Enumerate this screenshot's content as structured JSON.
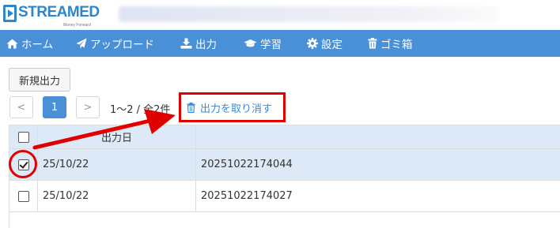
{
  "brand": {
    "logo_text": "STREAMED",
    "logo_subtext": "Money Forward"
  },
  "nav": {
    "items": [
      {
        "label": "ホーム",
        "icon": "home-icon"
      },
      {
        "label": "アップロード",
        "icon": "paper-plane-icon"
      },
      {
        "label": "出力",
        "icon": "download-icon"
      },
      {
        "label": "学習",
        "icon": "graduation-cap-icon"
      },
      {
        "label": "設定",
        "icon": "gear-icon"
      },
      {
        "label": "ゴミ箱",
        "icon": "trash-icon"
      }
    ]
  },
  "toolbar": {
    "new_output_label": "新規出力"
  },
  "pagination": {
    "prev": "<",
    "current_page": "1",
    "next": ">",
    "range_info": "1〜2 / 全2件"
  },
  "actions": {
    "cancel_output_label": "出力を取り消す"
  },
  "table": {
    "headers": {
      "date": "出力日",
      "name": ""
    },
    "rows": [
      {
        "checked": true,
        "date": "25/10/22",
        "name": "20251022174044"
      },
      {
        "checked": false,
        "date": "25/10/22",
        "name": "20251022174027"
      }
    ]
  },
  "colors": {
    "brand_blue": "#2e86c9",
    "nav_blue": "#4a90d6",
    "selected_row": "#dde9f6",
    "annotation_red": "#e00000",
    "link_blue": "#3a8bd6"
  }
}
